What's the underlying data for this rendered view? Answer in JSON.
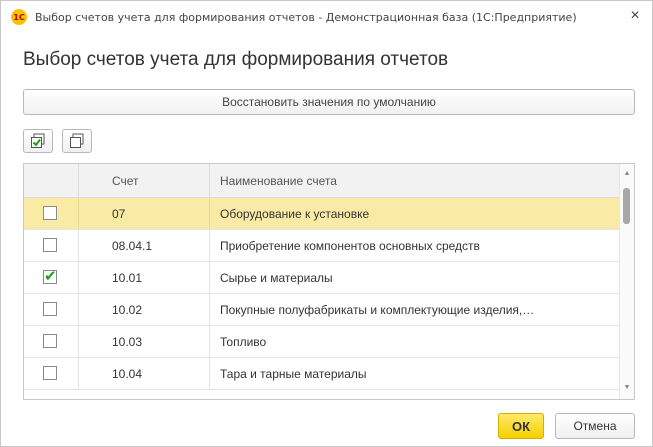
{
  "window": {
    "app_icon_text": "1С",
    "title": "Выбор счетов учета для формирования отчетов - Демонстрационная база  (1С:Предприятие)",
    "close_glyph": "×"
  },
  "form": {
    "heading": "Выбор счетов учета для формирования отчетов",
    "restore_defaults_label": "Восстановить значения по умолчанию"
  },
  "toolbar": {
    "check_all_icon": "check-all-icon",
    "uncheck_all_icon": "uncheck-all-icon"
  },
  "table": {
    "columns": [
      "Счет",
      "Наименование счета"
    ],
    "rows": [
      {
        "code": "07",
        "name": "Оборудование к установке",
        "checked": false,
        "selected": true
      },
      {
        "code": "08.04.1",
        "name": "Приобретение компонентов основных средств",
        "checked": false,
        "selected": false
      },
      {
        "code": "10.01",
        "name": "Сырье и материалы",
        "checked": true,
        "selected": false
      },
      {
        "code": "10.02",
        "name": "Покупные полуфабрикаты и комплектующие изделия,…",
        "checked": false,
        "selected": false
      },
      {
        "code": "10.03",
        "name": "Топливо",
        "checked": false,
        "selected": false
      },
      {
        "code": "10.04",
        "name": "Тара и тарные материалы",
        "checked": false,
        "selected": false
      }
    ]
  },
  "buttons": {
    "ok_label": "ОК",
    "cancel_label": "Отмена"
  },
  "colors": {
    "selected_row": "#f9eba6",
    "ok_button": "#f5d000",
    "check_mark": "#1aa01a"
  }
}
